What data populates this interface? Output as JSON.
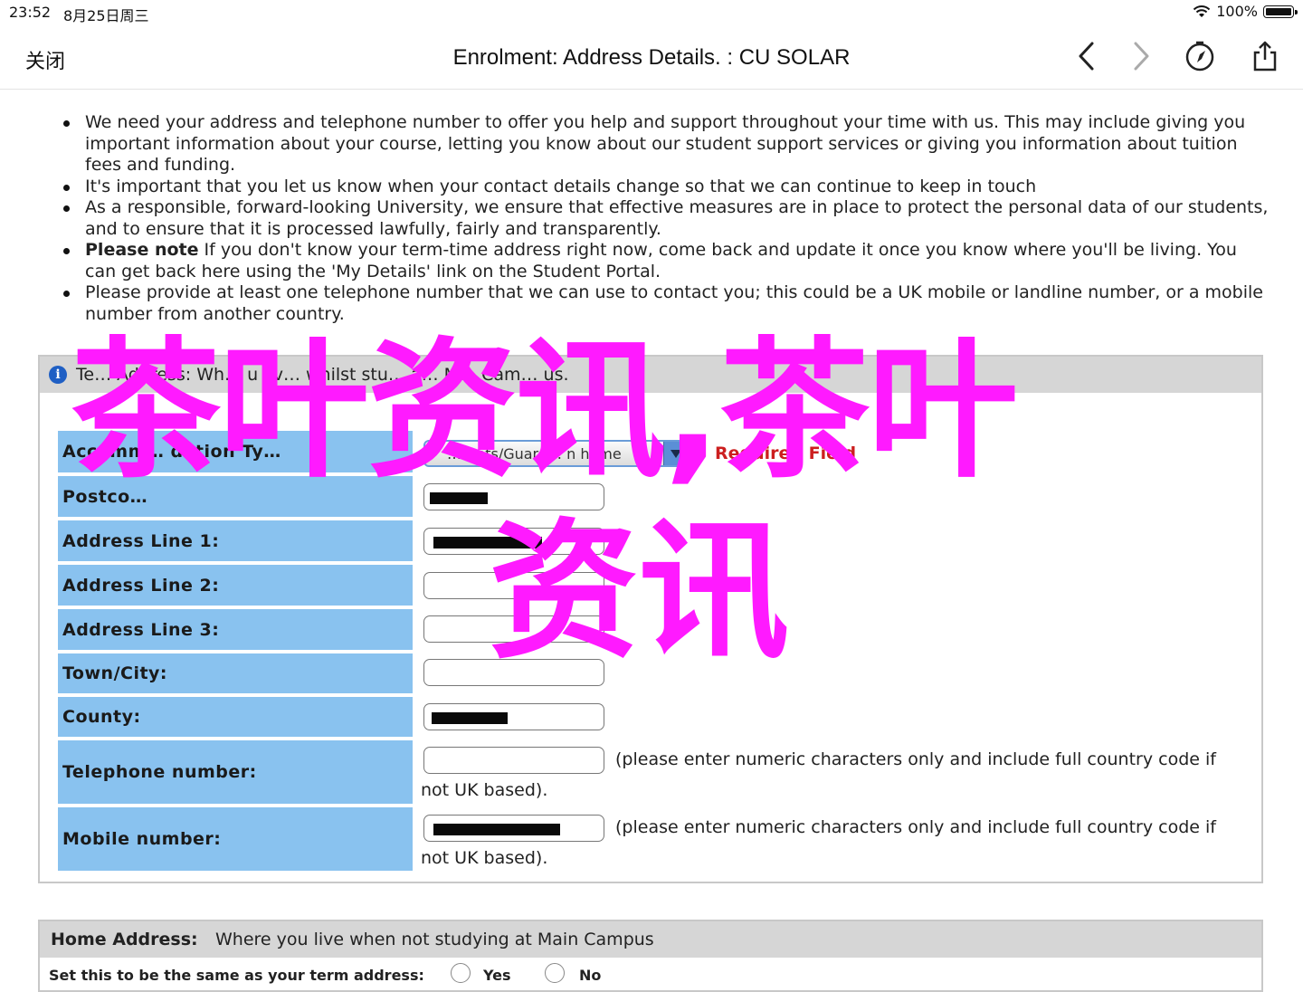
{
  "status_bar": {
    "time": "23:52",
    "date": "8月25日周三",
    "battery": "100%"
  },
  "nav": {
    "close_label": "关闭",
    "title": "Enrolment: Address Details. : CU SOLAR",
    "icons": [
      "chevron-left-icon",
      "chevron-right-icon",
      "compass-icon",
      "share-icon"
    ]
  },
  "intro_bullets": [
    {
      "text": "We need your address and telephone number to offer you help and support throughout your time with us. This may include giving you important information about your course, letting you know about our student support services or giving you information about tuition fees and funding."
    },
    {
      "text": "It's important that you let us know when your contact details change so that we can continue to keep in touch"
    },
    {
      "text": "As a responsible, forward-looking University, we ensure that effective measures are in place to protect the personal data of our students, and to ensure that it is processed lawfully, fairly and transparently."
    },
    {
      "bold": "Please note",
      "text": " If you don't know your term-time address right now, come back and update it once you know where you'll be living. You can get back here using the 'My Details' link on the Student Portal."
    },
    {
      "text": "Please provide at least one telephone number that we can use to contact you; this could be a UK mobile or landline number, or a mobile number from another country."
    }
  ],
  "term_panel": {
    "header_visible": "Te… Address: Wh… u liv… whilst stu… a… M… Cam… us.",
    "accommodation_label": "Accomm… dation Ty…",
    "accommodation_value": "…rents/Guard… n home",
    "required_label": "Required Field",
    "postcode_label": "Postco…",
    "address1_label": "Address Line 1:",
    "address2_label": "Address Line 2:",
    "address3_label": "Address Line 3:",
    "town_label": "Town/City:",
    "county_label": "County:",
    "telephone_label": "Telephone number:",
    "mobile_label": "Mobile number:",
    "phone_hint_line1": "(please enter numeric characters only and include full country code if",
    "phone_hint_line2": "not UK based)."
  },
  "home_panel": {
    "title": "Home Address:",
    "subtitle": "Where you live when not studying at Main Campus",
    "same_label": "Set this to be the same as your term address:",
    "yes_label": "Yes",
    "no_label": "No"
  },
  "watermark": {
    "line1": "茶叶资讯,茶叶",
    "line2": "资讯",
    "color": "#ff1aff"
  }
}
